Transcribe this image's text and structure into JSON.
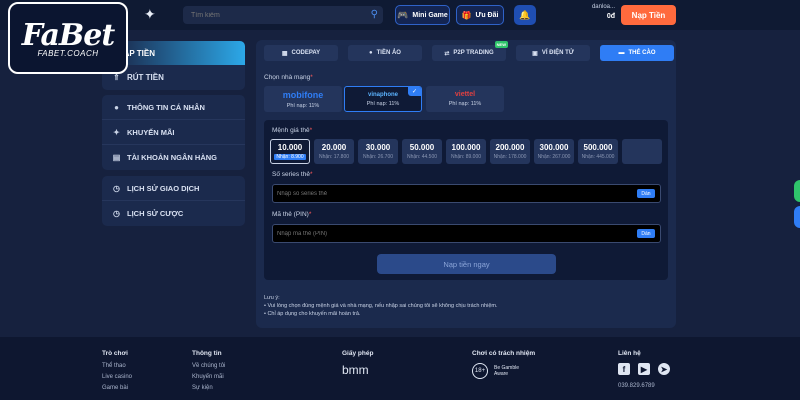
{
  "brand": {
    "logo_text": "FaBet",
    "logo_sub": "FABET.COACH"
  },
  "search": {
    "placeholder": "Tìm kiếm"
  },
  "header": {
    "mini_game": "Mini Game",
    "promo": "Ưu Đãi",
    "username": "danloa...",
    "balance": "0đ",
    "deposit": "Nạp Tiền"
  },
  "sidebar": {
    "active_item": "NẠP TIỀN",
    "withdraw": "RÚT TIỀN",
    "group2": [
      "THÔNG TIN CÁ NHÂN",
      "KHUYẾN MÃI",
      "TÀI KHOẢN NGÂN HÀNG"
    ],
    "group3": [
      "LỊCH SỬ GIAO DỊCH",
      "LỊCH SỬ CƯỢC"
    ]
  },
  "tabs": [
    {
      "label": "CODEPAY",
      "icon": "qr-icon"
    },
    {
      "label": "TIỀN ẢO",
      "icon": "coin-icon"
    },
    {
      "label": "P2P TRADING",
      "icon": "exchange-icon",
      "badge": "NEW"
    },
    {
      "label": "VÍ ĐIỆN TỬ",
      "icon": "wallet-icon"
    },
    {
      "label": "THẺ CÀO",
      "icon": "card-icon",
      "active": true
    }
  ],
  "carrier_section": {
    "label": "Chọn nhà mạng",
    "carriers": [
      {
        "name": "mobifone",
        "fee": "Phí nạp: 11%",
        "color": "#2f7df5"
      },
      {
        "name": "vinaphone",
        "fee": "Phí nạp: 11%",
        "color": "#5bb3ff",
        "selected": true
      },
      {
        "name": "viettel",
        "fee": "Phí nạp: 11%",
        "color": "#e04040"
      }
    ]
  },
  "denomination": {
    "label": "Mệnh giá thẻ",
    "items": [
      {
        "value": "10.000",
        "receive": "Nhận: 8.900",
        "selected": true
      },
      {
        "value": "20.000",
        "receive": "Nhận: 17.800"
      },
      {
        "value": "30.000",
        "receive": "Nhận: 26.700"
      },
      {
        "value": "50.000",
        "receive": "Nhận: 44.500"
      },
      {
        "value": "100.000",
        "receive": "Nhận: 89.000"
      },
      {
        "value": "200.000",
        "receive": "Nhận: 178.000"
      },
      {
        "value": "300.000",
        "receive": "Nhận: 267.000"
      },
      {
        "value": "500.000",
        "receive": "Nhận: 445.000"
      }
    ]
  },
  "serial": {
    "label": "Số series thẻ",
    "placeholder": "Nhập số series thẻ",
    "paste": "Dán"
  },
  "pin": {
    "label": "Mã thẻ (PIN)",
    "placeholder": "Nhập mã thẻ (PIN)",
    "paste": "Dán"
  },
  "submit_label": "Nạp tiền ngay",
  "notes": {
    "title": "Lưu ý:",
    "lines": [
      "• Vui lòng chọn đúng mệnh giá và nhà mạng, nếu nhập sai chúng tôi sẽ không chịu trách nhiệm.",
      "• Chỉ áp dụng cho khuyến mãi hoàn trả."
    ]
  },
  "footer": {
    "games": {
      "title": "Trò chơi",
      "items": [
        "Thể thao",
        "Live casino",
        "Game bài"
      ]
    },
    "info": {
      "title": "Thông tin",
      "items": [
        "Về chúng tôi",
        "Khuyến mãi",
        "Sự kiện"
      ]
    },
    "license": {
      "title": "Giấy phép",
      "logo": "bmm"
    },
    "responsible": {
      "title": "Chơi có trách nhiệm",
      "age": "18+",
      "aware": "Be Gamble Aware"
    },
    "contact": {
      "title": "Liên hệ",
      "phone": "039.829.6789"
    }
  }
}
